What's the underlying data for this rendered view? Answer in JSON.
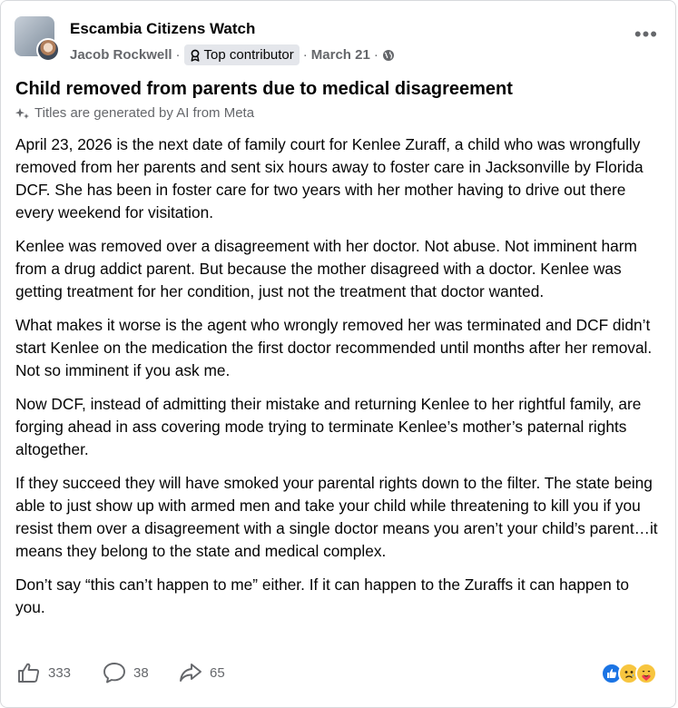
{
  "post": {
    "group_name": "Escambia Citizens Watch",
    "author": "Jacob Rockwell",
    "badge": "Top contributor",
    "separator": "·",
    "date": "March 21",
    "more_label": "•••",
    "title": "Child removed from parents due to medical disagreement",
    "ai_note": "Titles are generated by AI from Meta",
    "paragraphs": [
      "April 23, 2026 is the next date of family court for Kenlee Zuraff, a child who was wrongfully removed from her parents and sent six hours away to foster care in Jacksonville by Florida DCF. She has been in foster care for two years with her mother having to drive out there every weekend for visitation.",
      "Kenlee was removed over a disagreement with her doctor. Not abuse. Not imminent harm from a drug addict parent. But because the mother disagreed with a doctor. Kenlee was getting treatment for her condition, just not the treatment that doctor wanted.",
      "What makes it worse is the agent who wrongly removed her was terminated and DCF didn’t start Kenlee on the medication the first doctor recommended until months after her removal. Not so imminent if you ask me.",
      "Now DCF, instead of admitting their mistake and returning Kenlee to her rightful family, are forging ahead in ass covering mode trying to terminate Kenlee’s mother’s paternal rights altogether.",
      "If they succeed they will have smoked your parental rights down to the filter. The state being able to just show up with armed men and take your child while threatening to kill you if you resist them over a disagreement with a single doctor means you aren’t your child’s parent…it means they belong to the state and medical complex.",
      "Don’t say “this can’t happen to me” either. If it can happen to the Zuraffs it can happen to you."
    ]
  },
  "footer": {
    "likes": "333",
    "comments": "38",
    "shares": "65"
  },
  "icons": {
    "badge": "contributor-badge-icon",
    "audience": "globe-icon",
    "ai": "sparkle-icon",
    "like": "thumb-up-icon",
    "comment": "comment-bubble-icon",
    "share": "share-arrow-icon"
  },
  "colors": {
    "text": "#050505",
    "secondary": "#65676b",
    "like_blue": "#1b74e4",
    "badge_bg": "#e4e6eb"
  }
}
